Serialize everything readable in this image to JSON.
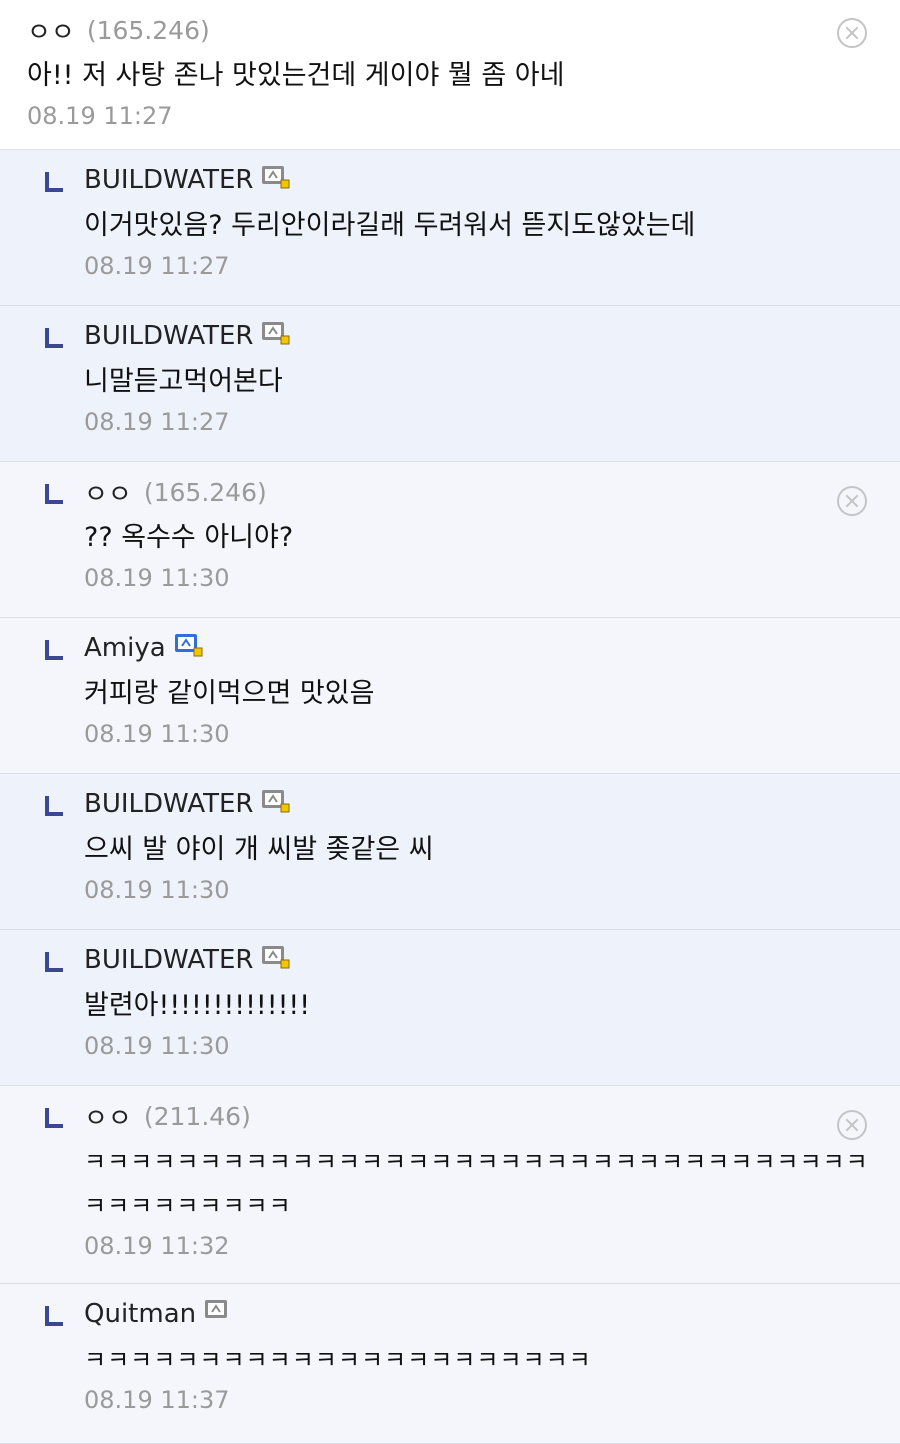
{
  "comments": [
    {
      "nick": "ㅇㅇ",
      "ip": "(165.246)",
      "text": "아!! 저 사탕 존나 맛있는건데 게이야 뭘 좀 아네",
      "date": "08.19 11:27"
    },
    {
      "nick": "BUILDWATER",
      "text": "이거맛있음? 두리안이라길래 두려워서 뜯지도않았는데",
      "date": "08.19 11:27"
    },
    {
      "nick": "BUILDWATER",
      "text": "니말듣고먹어본다",
      "date": "08.19 11:27"
    },
    {
      "nick": "ㅇㅇ",
      "ip": "(165.246)",
      "text": "?? 옥수수 아니야?",
      "date": "08.19 11:30"
    },
    {
      "nick": "Amiya",
      "text": "커피랑 같이먹으면 맛있음",
      "date": "08.19 11:30"
    },
    {
      "nick": "BUILDWATER",
      "text": "으씨 발 야이 개 씨발 좆같은 씨",
      "date": "08.19 11:30"
    },
    {
      "nick": "BUILDWATER",
      "text": "발련아!!!!!!!!!!!!!!",
      "date": "08.19 11:30"
    },
    {
      "nick": "ㅇㅇ",
      "ip": "(211.46)",
      "text": "ㅋㅋㅋㅋㅋㅋㅋㅋㅋㅋㅋㅋㅋㅋㅋㅋㅋㅋㅋㅋㅋㅋㅋㅋㅋㅋㅋㅋㅋㅋㅋㅋㅋㅋㅋㅋㅋㅋㅋㅋㅋㅋㅋ",
      "date": "08.19 11:32"
    },
    {
      "nick": "Quitman",
      "text": "ㅋㅋㅋㅋㅋㅋㅋㅋㅋㅋㅋㅋㅋㅋㅋㅋㅋㅋㅋㅋㅋㅋ",
      "date": "08.19 11:37"
    }
  ],
  "icons": {
    "gallog_gray": "#8a8a8a",
    "gallog_blue": "#2f6fd8",
    "badge_yellow": "#f2c500",
    "reply_arrow": "#3b4890"
  }
}
